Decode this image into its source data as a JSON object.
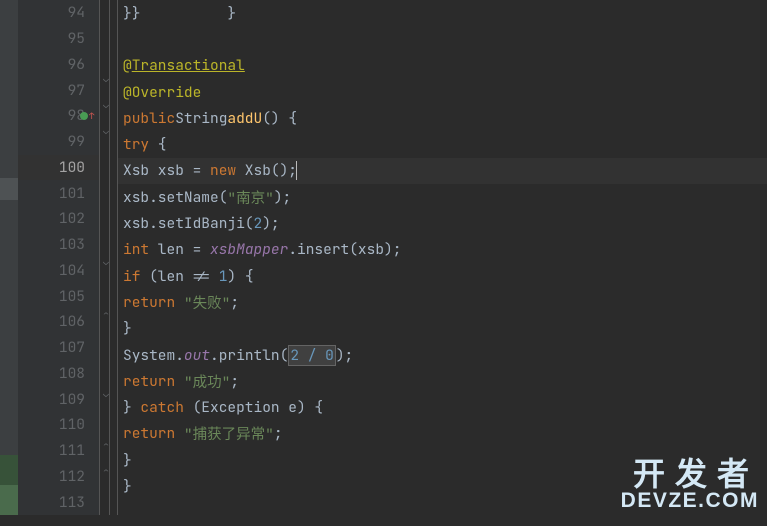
{
  "gutter": {
    "lines": [
      "94",
      "95",
      "96",
      "97",
      "98",
      "99",
      "100",
      "101",
      "102",
      "103",
      "104",
      "105",
      "106",
      "107",
      "108",
      "109",
      "110",
      "111",
      "112",
      "113"
    ],
    "current_index": 6
  },
  "code": {
    "l94": {
      "indent": "}}          }",
      "text": ""
    },
    "l96_annot_at": "@",
    "l96_annot_name": "Transactional",
    "l97_annot": "@Override",
    "l98_public": "public",
    "l98_type": "String",
    "l98_method": "addU",
    "l98_paren": "() {",
    "l99_try": "try",
    "l99_brace": " {",
    "l100_type": "Xsb xsb = ",
    "l100_new": "new",
    "l100_ctor": " Xsb();",
    "l101_text": "xsb.setName(",
    "l101_str": "\"南京\"",
    "l101_end": ");",
    "l102_text": "xsb.setIdBanji(",
    "l102_num": "2",
    "l102_end": ");",
    "l103_int": "int",
    "l103_text": " len = ",
    "l103_mapper": "xsbMapper",
    "l103_call": ".insert(xsb);",
    "l104_if": "if",
    "l104_text": " (len != ",
    "l104_num": "1",
    "l104_end": ") {",
    "l105_return": "return",
    "l105_sp": " ",
    "l105_str": "\"失败\"",
    "l105_end": ";",
    "l106_brace": "}",
    "l107_sys": "System.",
    "l107_out": "out",
    "l107_print": ".println(",
    "l107_expr": "2 / 0",
    "l107_end": ");",
    "l108_return": "return",
    "l108_sp": " ",
    "l108_str": "\"成功\"",
    "l108_end": ";",
    "l109_brace": "} ",
    "l109_catch": "catch",
    "l109_text": " (Exception e) {",
    "l110_return": "return",
    "l110_sp": " ",
    "l110_str": "\"捕获了异常\"",
    "l110_end": ";",
    "l111_brace": "}",
    "l112_brace": "}"
  },
  "watermark": {
    "line1": "开发者",
    "line2": "DEVZE.COM"
  }
}
